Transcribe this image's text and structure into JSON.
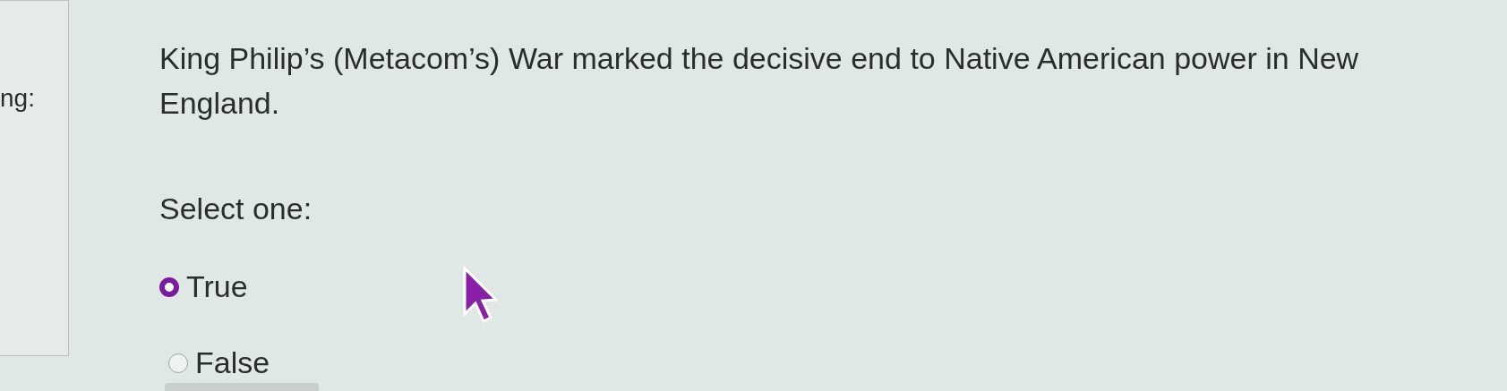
{
  "sidebar": {
    "label": "ng:"
  },
  "question": {
    "text": "King Philip’s (Metacom’s) War marked the decisive end to Native American power in New England.",
    "prompt": "Select one:",
    "options": [
      {
        "label": "True",
        "selected": true
      },
      {
        "label": "False",
        "selected": false
      }
    ]
  }
}
